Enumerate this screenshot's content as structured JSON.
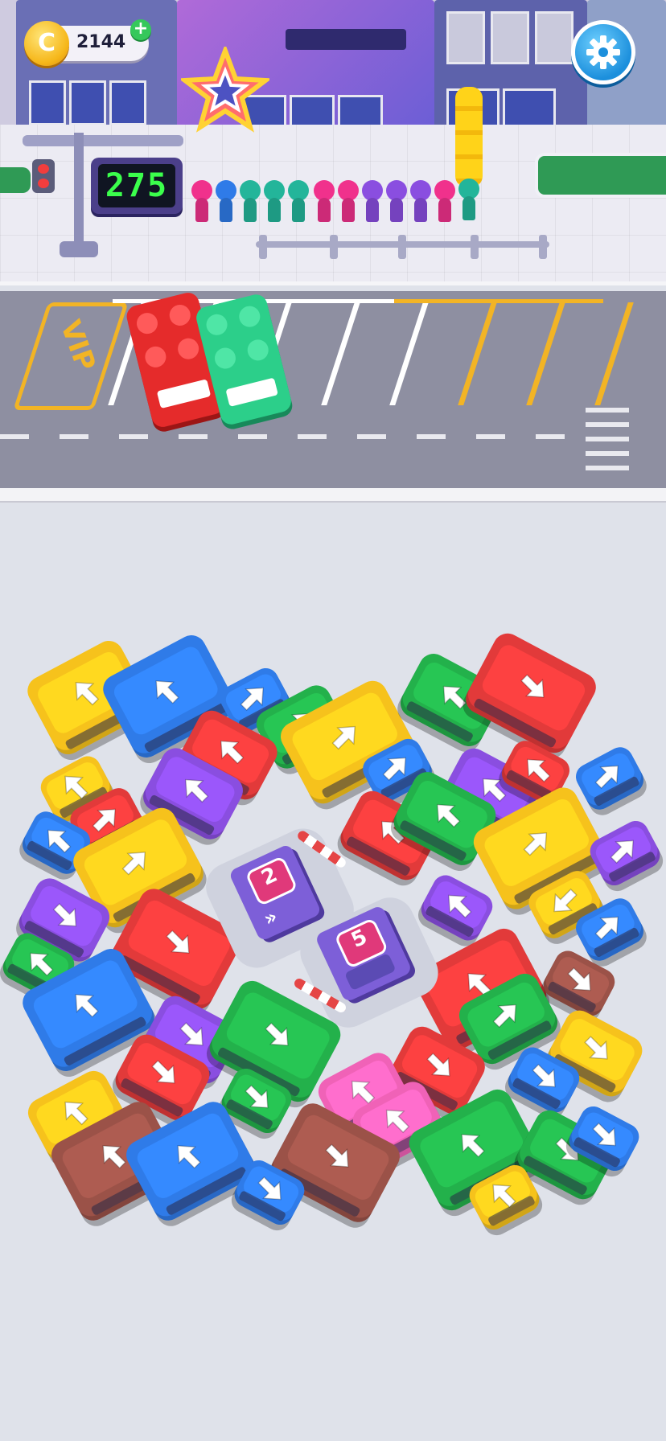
{
  "hud": {
    "coins": "2144",
    "coin_plus": "+",
    "coin_symbol": "C",
    "score": "275"
  },
  "lot": {
    "vip_label": "VIP"
  },
  "kiosks": [
    {
      "id": "kiosk-2",
      "number": "2"
    },
    {
      "id": "kiosk-5",
      "number": "5"
    }
  ],
  "colors": {
    "yellow": "#f6c21c",
    "blue": "#2f7be8",
    "red": "#e23a3a",
    "green": "#23b14b",
    "purple": "#8a4ee0",
    "pink": "#f062b7",
    "brown": "#9b5248",
    "teal": "#28c796"
  },
  "queue_colors": [
    "#f0318c",
    "#2f7be8",
    "#23b59a",
    "#23b59a",
    "#23b59a",
    "#f0318c",
    "#f0318c",
    "#8a4ee0",
    "#8a4ee0",
    "#8a4ee0",
    "#f0318c",
    "#23b59a"
  ],
  "vehicles": [
    {
      "color": "yellow",
      "type": "bus",
      "arrow": "up-left"
    },
    {
      "color": "blue",
      "type": "bus",
      "arrow": "up-left"
    },
    {
      "color": "blue",
      "type": "car",
      "arrow": "up-right"
    },
    {
      "color": "green",
      "type": "bus",
      "arrow": "up-right"
    },
    {
      "color": "yellow",
      "type": "bus",
      "arrow": "up-right"
    },
    {
      "color": "green",
      "type": "bus",
      "arrow": "up-left"
    },
    {
      "color": "red",
      "type": "bus",
      "arrow": "down-right"
    },
    {
      "color": "red",
      "type": "bus",
      "arrow": "up-left"
    },
    {
      "color": "yellow",
      "type": "car",
      "arrow": "up-left"
    },
    {
      "color": "purple",
      "type": "bus",
      "arrow": "up-left"
    },
    {
      "color": "blue",
      "type": "car",
      "arrow": "up-right"
    },
    {
      "color": "purple",
      "type": "bus",
      "arrow": "up-left"
    },
    {
      "color": "red",
      "type": "car",
      "arrow": "up-left"
    },
    {
      "color": "blue",
      "type": "car",
      "arrow": "up-right"
    },
    {
      "color": "red",
      "type": "car",
      "arrow": "up-right"
    },
    {
      "color": "blue",
      "type": "car",
      "arrow": "up-left"
    },
    {
      "color": "yellow",
      "type": "bus",
      "arrow": "up-right"
    },
    {
      "color": "red",
      "type": "bus",
      "arrow": "up-left"
    },
    {
      "color": "green",
      "type": "bus",
      "arrow": "up-left"
    },
    {
      "color": "yellow",
      "type": "bus",
      "arrow": "up-right"
    },
    {
      "color": "purple",
      "type": "car",
      "arrow": "up-right"
    },
    {
      "color": "purple",
      "type": "bus",
      "arrow": "down-right"
    },
    {
      "color": "purple",
      "type": "car",
      "arrow": "up-left"
    },
    {
      "color": "yellow",
      "type": "car",
      "arrow": "down-left"
    },
    {
      "color": "blue",
      "type": "car",
      "arrow": "up-right"
    },
    {
      "color": "green",
      "type": "car",
      "arrow": "up-left"
    },
    {
      "color": "red",
      "type": "bus",
      "arrow": "down-right"
    },
    {
      "color": "red",
      "type": "bus",
      "arrow": "up-left"
    },
    {
      "color": "brown",
      "type": "car",
      "arrow": "down-right"
    },
    {
      "color": "blue",
      "type": "bus",
      "arrow": "up-left"
    },
    {
      "color": "purple",
      "type": "bus",
      "arrow": "down-right"
    },
    {
      "color": "green",
      "type": "bus",
      "arrow": "down-right"
    },
    {
      "color": "green",
      "type": "bus",
      "arrow": "up-right"
    },
    {
      "color": "red",
      "type": "bus",
      "arrow": "down-right"
    },
    {
      "color": "yellow",
      "type": "bus",
      "arrow": "down-right"
    },
    {
      "color": "red",
      "type": "bus",
      "arrow": "down-right"
    },
    {
      "color": "green",
      "type": "car",
      "arrow": "down-right"
    },
    {
      "color": "pink",
      "type": "bus",
      "arrow": "up-left"
    },
    {
      "color": "blue",
      "type": "car",
      "arrow": "down-right"
    },
    {
      "color": "yellow",
      "type": "bus",
      "arrow": "up-left"
    },
    {
      "color": "pink",
      "type": "bus",
      "arrow": "up-left"
    },
    {
      "color": "green",
      "type": "bus",
      "arrow": "up-left"
    },
    {
      "color": "green",
      "type": "bus",
      "arrow": "down-right"
    },
    {
      "color": "blue",
      "type": "car",
      "arrow": "down-right"
    },
    {
      "color": "brown",
      "type": "bus",
      "arrow": "up-left"
    },
    {
      "color": "blue",
      "type": "bus",
      "arrow": "up-left"
    },
    {
      "color": "brown",
      "type": "bus",
      "arrow": "down-right"
    },
    {
      "color": "blue",
      "type": "car",
      "arrow": "down-right"
    },
    {
      "color": "yellow",
      "type": "car",
      "arrow": "up-left"
    }
  ]
}
